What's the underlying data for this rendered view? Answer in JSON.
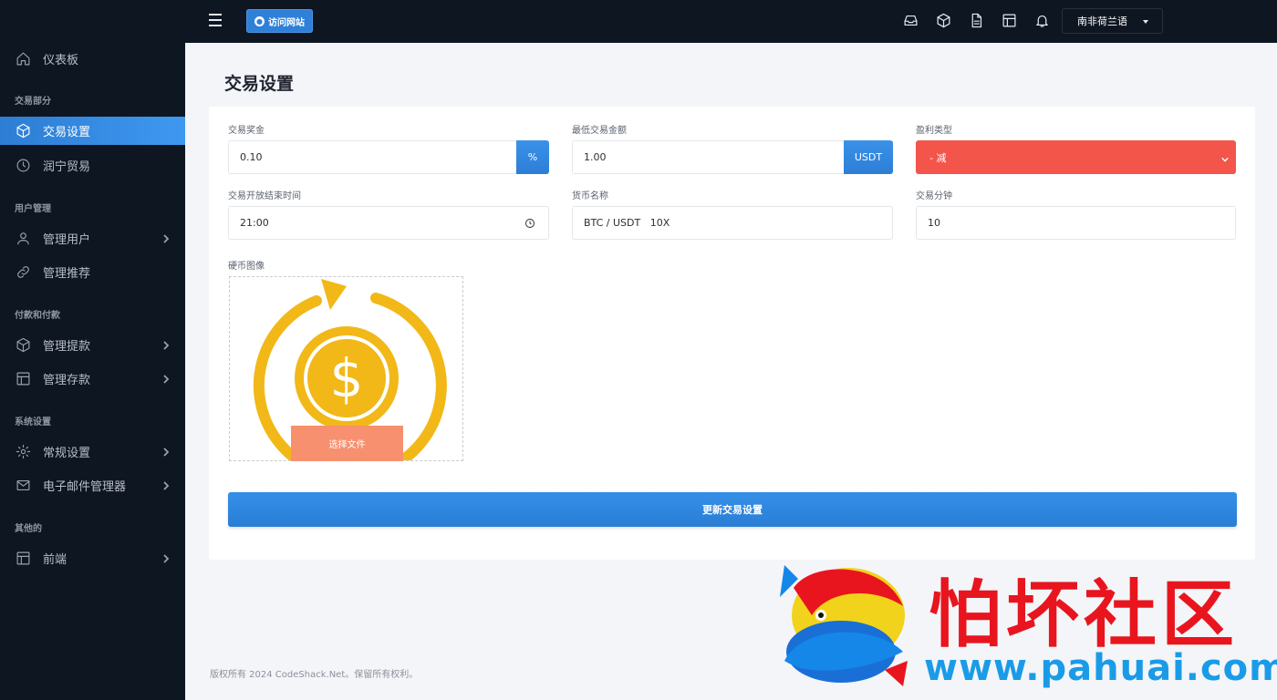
{
  "sidebar": {
    "items": [
      {
        "label": "仪表板",
        "icon": "home-icon"
      },
      {
        "label": "交易设置",
        "icon": "cube-icon",
        "active": true
      },
      {
        "label": "润宁贸易",
        "icon": "clock-icon"
      },
      {
        "label": "管理用户",
        "icon": "user-icon"
      },
      {
        "label": "管理推荐",
        "icon": "link-icon"
      },
      {
        "label": "管理提款",
        "icon": "cube-icon"
      },
      {
        "label": "管理存款",
        "icon": "table-icon"
      },
      {
        "label": "常规设置",
        "icon": "gear-icon"
      },
      {
        "label": "电子邮件管理器",
        "icon": "mail-icon"
      },
      {
        "label": "前端",
        "icon": "layout-icon"
      }
    ],
    "sections": [
      "交易部分",
      "用户管理",
      "付款和付款",
      "系统设置",
      "其他的"
    ]
  },
  "topbar": {
    "visit_label": "访问网站",
    "language": "南非荷兰语"
  },
  "page": {
    "title": "交易设置"
  },
  "form": {
    "trade_bonus_label": "交易奖金",
    "trade_bonus_value": "0.10",
    "trade_bonus_addon": "%",
    "min_amount_label": "最低交易金额",
    "min_amount_value": "1.00",
    "min_amount_addon": "USDT",
    "profit_type_label": "盈利类型",
    "profit_type_value": "- 减",
    "open_time_label": "交易开放结束时间",
    "open_time_value": "21:00",
    "currency_name_label": "货币名称",
    "currency_name_value": "BTC / USDT   10X",
    "trade_minutes_label": "交易分钟",
    "trade_minutes_value": "10",
    "coin_image_label": "硬币图像",
    "choose_file_label": "选择文件",
    "submit_label": "更新交易设置"
  },
  "footer": {
    "text": "版权所有 2024 CodeShack.Net。保留所有权利。"
  },
  "watermark": {
    "title": "怕坏社区",
    "url": "www.pahuai.com"
  },
  "colors": {
    "sidebar_bg": "#0e1622",
    "accent": "#2f80d8",
    "danger": "#f3554a",
    "file_button": "#f7906f",
    "coin": "#f2b818"
  }
}
